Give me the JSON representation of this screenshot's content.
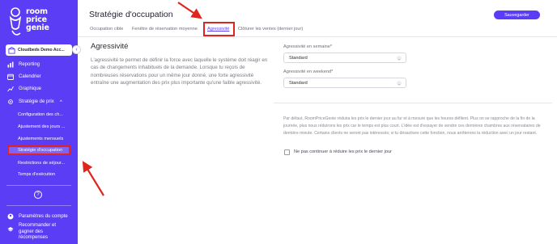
{
  "brand": {
    "name_lines": [
      "room",
      "price",
      "genie"
    ]
  },
  "sidebar": {
    "hotel": "Cloudbeds Demo Acc...",
    "items": [
      {
        "label": "Reporting",
        "icon": "chart-icon"
      },
      {
        "label": "Calendrier",
        "icon": "calendar-icon"
      },
      {
        "label": "Graphique",
        "icon": "graph-icon"
      },
      {
        "label": "Stratégie de prix",
        "icon": "gear-icon"
      }
    ],
    "sub_items": [
      {
        "label": "Configuration des ch..."
      },
      {
        "label": "Ajustement des jours ..."
      },
      {
        "label": "Ajustements mensuels"
      },
      {
        "label": "Stratégie d'occupation"
      },
      {
        "label": "Restrictions de séjour..."
      },
      {
        "label": "Temps d'exécution"
      }
    ],
    "help_symbol": "?",
    "bottom_items": [
      {
        "label": "Paramètres du compte",
        "icon": "account-icon"
      },
      {
        "label": "Recommander et gagner des récompenses",
        "icon": "gift-icon"
      }
    ]
  },
  "header": {
    "title": "Stratégie d'occupation",
    "save_label": "Sauvegarder"
  },
  "tabs": [
    {
      "label": "Occupation cible"
    },
    {
      "label": "Fenêtre de réservation moyenne"
    },
    {
      "label": "Agressivité"
    },
    {
      "label": "Clôturer les ventes (dernier jour)"
    }
  ],
  "section": {
    "title": "Agressivité",
    "description": "L'agressivité te permet de définir la force avec laquelle le système doit réagir en cas de changements inhabituels de la demande. Lorsque tu reçois de nombreuses réservations pour un même jour donné, une forte agressivité entraîne une augmentation des prix plus importante qu'une faible agressivité."
  },
  "fields": {
    "weekday_label": "Agressivité en semaine*",
    "weekday_value": "Standard",
    "weekend_label": "Agressivité en weekend*",
    "weekend_value": "Standard"
  },
  "note": "Par défaut, RoomPriceGenie réduira les prix le dernier jour au fur et à mesure que les heures défilent. Plus on se rapproche de la fin de la journée, plus nous réduirons les prix car le temps est plus court. L'idée est d'essayer de vendre ces dernières chambres aux réservataires de dernière minute. Certains clients ne seront pas intéressés; si tu désactives cette fonction, nous arrêterons la réduction avec un jour restant.",
  "checkbox": {
    "label": "Ne pas continuer à réduire les prix le dernier jour",
    "checked": false
  },
  "colors": {
    "brand": "#5b3df5",
    "annotation": "#e0241e"
  }
}
